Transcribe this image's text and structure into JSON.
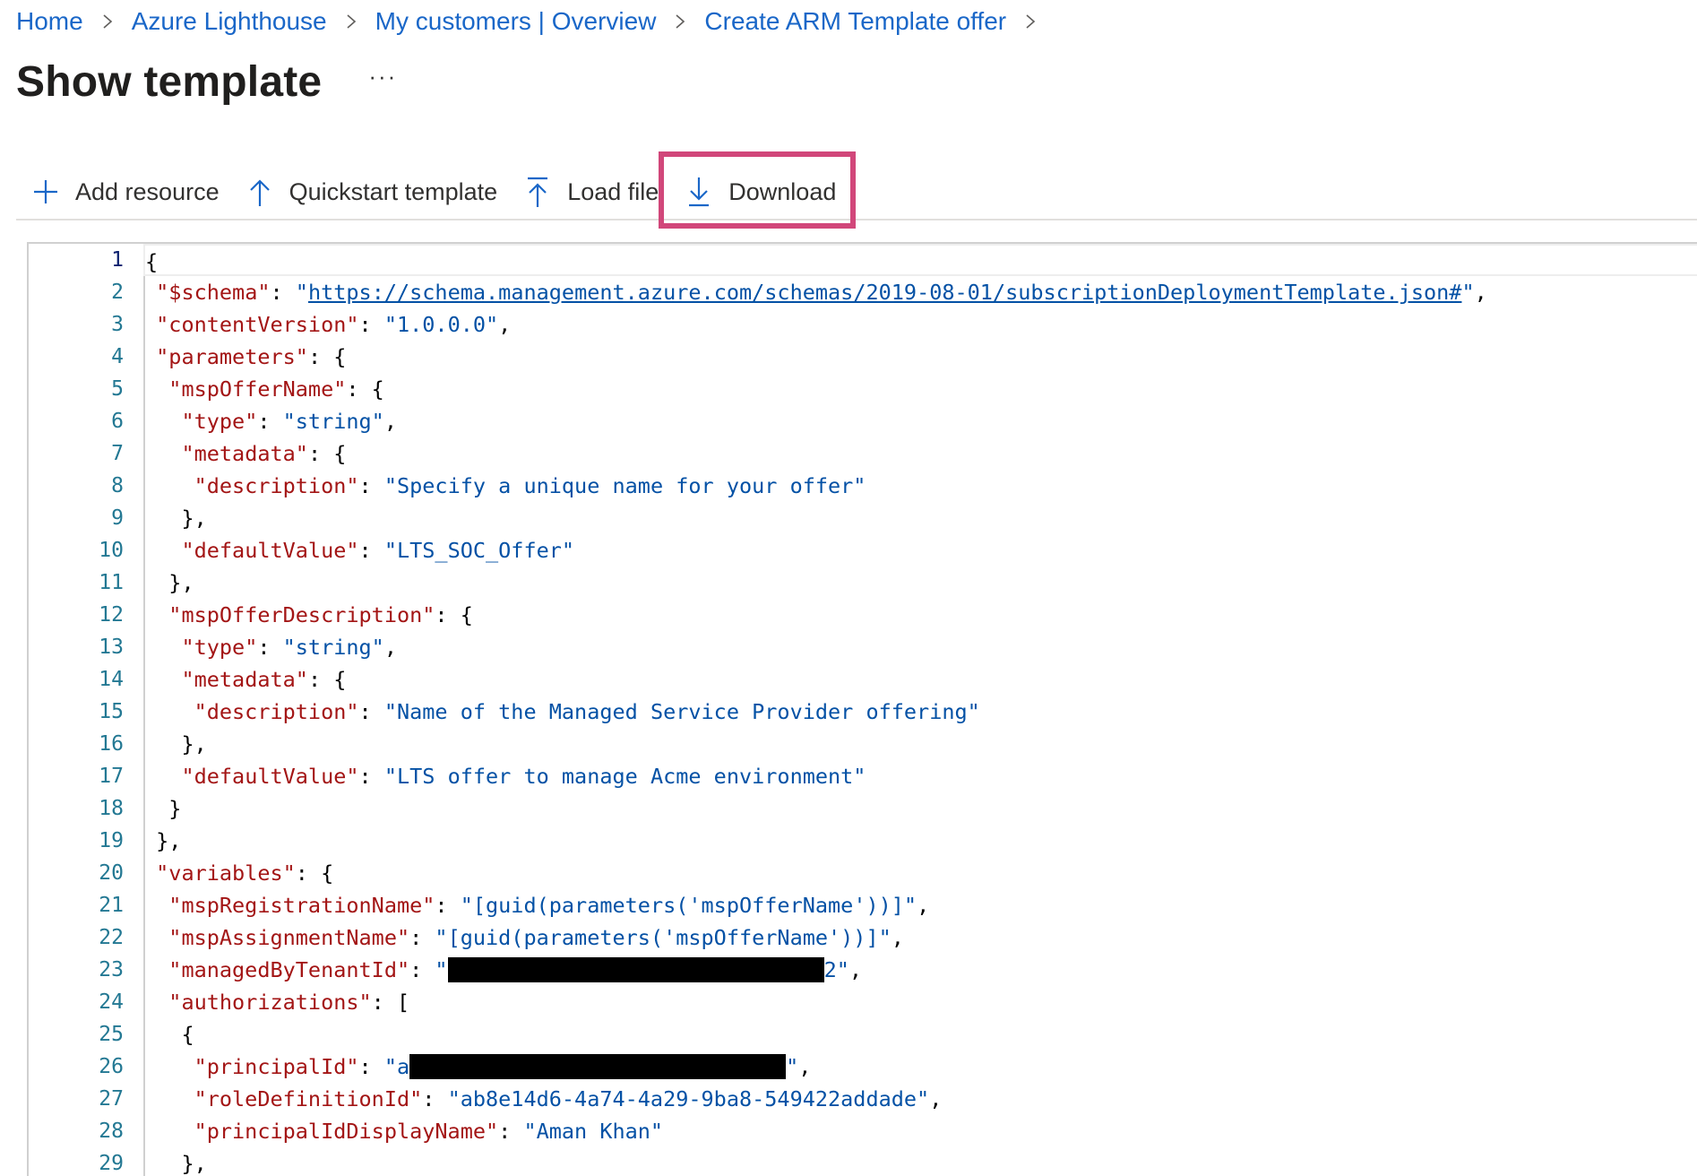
{
  "breadcrumb": {
    "items": [
      "Home",
      "Azure Lighthouse",
      "My customers | Overview",
      "Create ARM Template offer"
    ]
  },
  "page": {
    "title": "Show template",
    "more_label": "···"
  },
  "toolbar": {
    "add_resource": "Add resource",
    "quickstart_template": "Quickstart template",
    "load_file": "Load file",
    "download": "Download"
  },
  "editor": {
    "line_numbers": [
      "1",
      "2",
      "3",
      "4",
      "5",
      "6",
      "7",
      "8",
      "9",
      "10",
      "11",
      "12",
      "13",
      "14",
      "15",
      "16",
      "17",
      "18",
      "19",
      "20",
      "21",
      "22",
      "23",
      "24",
      "25",
      "26",
      "27",
      "28",
      "29"
    ],
    "lines": [
      {
        "indent": "",
        "tokens": [
          {
            "t": "p",
            "v": "{"
          }
        ]
      },
      {
        "indent": " ",
        "tokens": [
          {
            "t": "k",
            "v": "\"$schema\""
          },
          {
            "t": "p",
            "v": ": "
          },
          {
            "t": "s",
            "v": "\""
          },
          {
            "t": "su",
            "v": "https://schema.management.azure.com/schemas/2019-08-01/subscriptionDeploymentTemplate.json#"
          },
          {
            "t": "s",
            "v": "\""
          },
          {
            "t": "p",
            "v": ","
          }
        ]
      },
      {
        "indent": " ",
        "tokens": [
          {
            "t": "k",
            "v": "\"contentVersion\""
          },
          {
            "t": "p",
            "v": ": "
          },
          {
            "t": "s",
            "v": "\"1.0.0.0\""
          },
          {
            "t": "p",
            "v": ","
          }
        ]
      },
      {
        "indent": " ",
        "tokens": [
          {
            "t": "k",
            "v": "\"parameters\""
          },
          {
            "t": "p",
            "v": ": {"
          }
        ]
      },
      {
        "indent": "  ",
        "tokens": [
          {
            "t": "k",
            "v": "\"mspOfferName\""
          },
          {
            "t": "p",
            "v": ": {"
          }
        ]
      },
      {
        "indent": "   ",
        "tokens": [
          {
            "t": "k",
            "v": "\"type\""
          },
          {
            "t": "p",
            "v": ": "
          },
          {
            "t": "s",
            "v": "\"string\""
          },
          {
            "t": "p",
            "v": ","
          }
        ]
      },
      {
        "indent": "   ",
        "tokens": [
          {
            "t": "k",
            "v": "\"metadata\""
          },
          {
            "t": "p",
            "v": ": {"
          }
        ]
      },
      {
        "indent": "    ",
        "tokens": [
          {
            "t": "k",
            "v": "\"description\""
          },
          {
            "t": "p",
            "v": ": "
          },
          {
            "t": "s",
            "v": "\"Specify a unique name for your offer\""
          }
        ]
      },
      {
        "indent": "   ",
        "tokens": [
          {
            "t": "p",
            "v": "},"
          }
        ]
      },
      {
        "indent": "   ",
        "tokens": [
          {
            "t": "k",
            "v": "\"defaultValue\""
          },
          {
            "t": "p",
            "v": ": "
          },
          {
            "t": "s",
            "v": "\"LTS_SOC_Offer\""
          }
        ]
      },
      {
        "indent": "  ",
        "tokens": [
          {
            "t": "p",
            "v": "},"
          }
        ]
      },
      {
        "indent": "  ",
        "tokens": [
          {
            "t": "k",
            "v": "\"mspOfferDescription\""
          },
          {
            "t": "p",
            "v": ": {"
          }
        ]
      },
      {
        "indent": "   ",
        "tokens": [
          {
            "t": "k",
            "v": "\"type\""
          },
          {
            "t": "p",
            "v": ": "
          },
          {
            "t": "s",
            "v": "\"string\""
          },
          {
            "t": "p",
            "v": ","
          }
        ]
      },
      {
        "indent": "   ",
        "tokens": [
          {
            "t": "k",
            "v": "\"metadata\""
          },
          {
            "t": "p",
            "v": ": {"
          }
        ]
      },
      {
        "indent": "    ",
        "tokens": [
          {
            "t": "k",
            "v": "\"description\""
          },
          {
            "t": "p",
            "v": ": "
          },
          {
            "t": "s",
            "v": "\"Name of the Managed Service Provider offering\""
          }
        ]
      },
      {
        "indent": "   ",
        "tokens": [
          {
            "t": "p",
            "v": "},"
          }
        ]
      },
      {
        "indent": "   ",
        "tokens": [
          {
            "t": "k",
            "v": "\"defaultValue\""
          },
          {
            "t": "p",
            "v": ": "
          },
          {
            "t": "s",
            "v": "\"LTS offer to manage Acme environment\""
          }
        ]
      },
      {
        "indent": "  ",
        "tokens": [
          {
            "t": "p",
            "v": "}"
          }
        ]
      },
      {
        "indent": " ",
        "tokens": [
          {
            "t": "p",
            "v": "},"
          }
        ]
      },
      {
        "indent": " ",
        "tokens": [
          {
            "t": "k",
            "v": "\"variables\""
          },
          {
            "t": "p",
            "v": ": {"
          }
        ]
      },
      {
        "indent": "  ",
        "tokens": [
          {
            "t": "k",
            "v": "\"mspRegistrationName\""
          },
          {
            "t": "p",
            "v": ": "
          },
          {
            "t": "s",
            "v": "\"[guid(parameters('mspOfferName'))]\""
          },
          {
            "t": "p",
            "v": ","
          }
        ]
      },
      {
        "indent": "  ",
        "tokens": [
          {
            "t": "k",
            "v": "\"mspAssignmentName\""
          },
          {
            "t": "p",
            "v": ": "
          },
          {
            "t": "s",
            "v": "\"[guid(parameters('mspOfferName'))]\""
          },
          {
            "t": "p",
            "v": ","
          }
        ]
      },
      {
        "indent": "  ",
        "tokens": [
          {
            "t": "k",
            "v": "\"managedByTenantId\""
          },
          {
            "t": "p",
            "v": ": "
          },
          {
            "t": "s",
            "v": "\""
          },
          {
            "t": "r",
            "w": 35
          },
          {
            "t": "s",
            "v": "2\""
          },
          {
            "t": "p",
            "v": ","
          }
        ]
      },
      {
        "indent": "  ",
        "tokens": [
          {
            "t": "k",
            "v": "\"authorizations\""
          },
          {
            "t": "p",
            "v": ": ["
          }
        ]
      },
      {
        "indent": "   ",
        "tokens": [
          {
            "t": "p",
            "v": "{"
          }
        ]
      },
      {
        "indent": "    ",
        "tokens": [
          {
            "t": "k",
            "v": "\"principalId\""
          },
          {
            "t": "p",
            "v": ": "
          },
          {
            "t": "s",
            "v": "\"a"
          },
          {
            "t": "r",
            "w": 35
          },
          {
            "t": "s",
            "v": "\""
          },
          {
            "t": "p",
            "v": ","
          }
        ]
      },
      {
        "indent": "    ",
        "tokens": [
          {
            "t": "k",
            "v": "\"roleDefinitionId\""
          },
          {
            "t": "p",
            "v": ": "
          },
          {
            "t": "s",
            "v": "\"ab8e14d6-4a74-4a29-9ba8-549422addade\""
          },
          {
            "t": "p",
            "v": ","
          }
        ]
      },
      {
        "indent": "    ",
        "tokens": [
          {
            "t": "k",
            "v": "\"principalIdDisplayName\""
          },
          {
            "t": "p",
            "v": ": "
          },
          {
            "t": "s",
            "v": "\"Aman Khan\""
          }
        ]
      },
      {
        "indent": "   ",
        "tokens": [
          {
            "t": "p",
            "v": "},"
          }
        ]
      }
    ]
  },
  "colors": {
    "link": "#1a67c8",
    "key": "#a31515",
    "string": "#0451a5",
    "line_number": "#237893",
    "highlight": "#d1477a"
  },
  "icons": {
    "add": "plus-icon",
    "quickstart": "upload-arrow-icon",
    "load_file": "upload-arrow-icon",
    "download": "download-arrow-icon",
    "breadcrumb_separator": "chevron-right-icon"
  }
}
